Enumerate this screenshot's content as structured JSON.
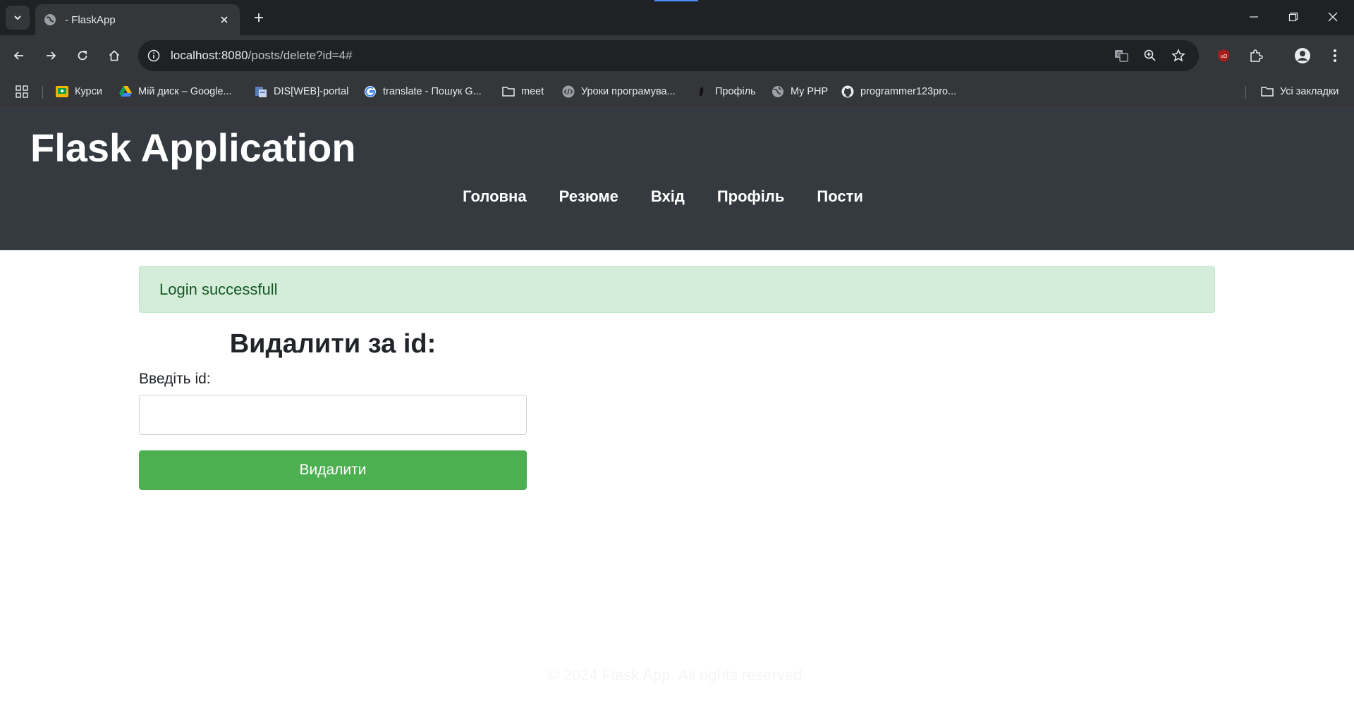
{
  "browser": {
    "tab_title": "- FlaskApp",
    "url_host": "localhost:8080",
    "url_path": "/posts/delete?id=4#"
  },
  "bookmarks": [
    {
      "label": "Курси",
      "icon": "classroom-icon"
    },
    {
      "label": "Мій диск – Google...",
      "icon": "drive-icon"
    },
    {
      "label": "DIS[WEB]-portal",
      "icon": "portal-icon"
    },
    {
      "label": "translate - Пошук G...",
      "icon": "google-icon"
    },
    {
      "label": "meet",
      "icon": "folder-icon"
    },
    {
      "label": "Уроки програмува...",
      "icon": "code-icon"
    },
    {
      "label": "Профіль",
      "icon": "profile-icon"
    },
    {
      "label": "My PHP",
      "icon": "globe-icon"
    },
    {
      "label": "programmer123pro...",
      "icon": "github-icon"
    }
  ],
  "all_bookmarks_label": "Усі закладки",
  "site": {
    "title": "Flask Application",
    "nav": [
      "Головна",
      "Резюме",
      "Вхід",
      "Профіль",
      "Пости"
    ]
  },
  "alert": {
    "message": "Login successfull"
  },
  "form": {
    "title": "Видалити за id:",
    "label": "Введіть id:",
    "input_value": "",
    "submit_label": "Видалити"
  },
  "footer": {
    "text": "© 2024 Flask App. All rights reserved."
  },
  "colors": {
    "header_bg": "#343a40",
    "alert_bg": "#d4edda",
    "alert_text": "#155724",
    "button_bg": "#4caf50"
  }
}
